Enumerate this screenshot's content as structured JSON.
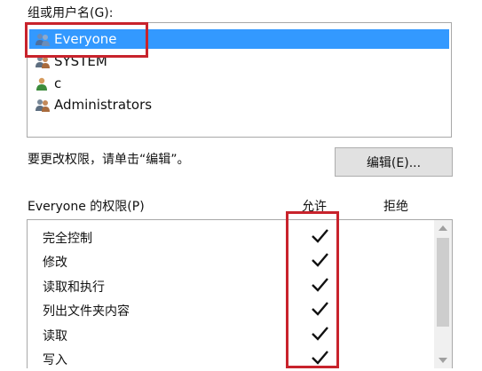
{
  "groups": {
    "label": "组或用户名(G):",
    "items": [
      {
        "name": "Everyone",
        "selected": true
      },
      {
        "name": "SYSTEM",
        "selected": false
      },
      {
        "name": "c",
        "selected": false
      },
      {
        "name": "Administrators",
        "selected": false
      }
    ]
  },
  "hint": "要更改权限，请单击“编辑”。",
  "edit_button": "编辑(E)...",
  "permissions": {
    "label": "Everyone 的权限(P)",
    "allow_header": "允许",
    "deny_header": "拒绝",
    "rows": [
      {
        "name": "完全控制",
        "allow": true,
        "deny": false
      },
      {
        "name": "修改",
        "allow": true,
        "deny": false
      },
      {
        "name": "读取和执行",
        "allow": true,
        "deny": false
      },
      {
        "name": "列出文件夹内容",
        "allow": true,
        "deny": false
      },
      {
        "name": "读取",
        "allow": true,
        "deny": false
      },
      {
        "name": "写入",
        "allow": true,
        "deny": false
      }
    ]
  },
  "highlight_color": "#c8232c",
  "selection_color": "#3399ff"
}
